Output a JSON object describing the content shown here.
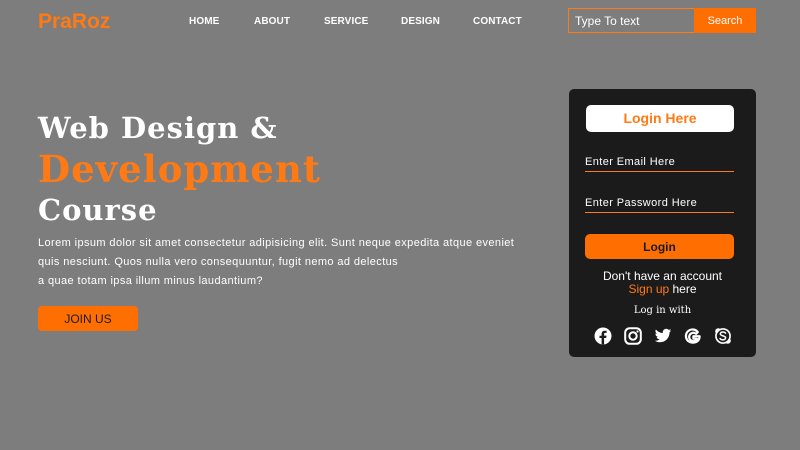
{
  "brand": {
    "logo": "PraRoz",
    "accent": "#ff7a14"
  },
  "nav": {
    "items": [
      {
        "label": "HOME"
      },
      {
        "label": "ABOUT"
      },
      {
        "label": "SERVICE"
      },
      {
        "label": "DESIGN"
      },
      {
        "label": "CONTACT"
      }
    ]
  },
  "search": {
    "placeholder": "Type To text",
    "button_label": "Search"
  },
  "hero": {
    "title_line1": "Web Design &",
    "title_line2": "Development",
    "title_line3": "Course",
    "desc_lines": [
      "Lorem ipsum dolor sit amet consectetur adipisicing elit. Sunt neque expedita atque eveniet",
      "quis nesciunt. Quos nulla vero consequuntur, fugit nemo ad delectus",
      "a quae totam ipsa illum minus laudantium?"
    ],
    "cta_label": "JOIN US"
  },
  "login_card": {
    "title": "Login Here",
    "email_placeholder": "Enter Email Here",
    "password_placeholder": "Enter Password Here",
    "login_button": "Login",
    "no_account_text": "Don't have an account",
    "signup_link": "Sign up",
    "signup_suffix": " here",
    "login_with": "Log in with",
    "socials": [
      "facebook-icon",
      "instagram-icon",
      "twitter-icon",
      "google-icon",
      "skype-icon"
    ]
  },
  "colors": {
    "background": "#7d7d7d",
    "card_background": "#1b1b1b",
    "button_orange": "#ff6e00"
  }
}
